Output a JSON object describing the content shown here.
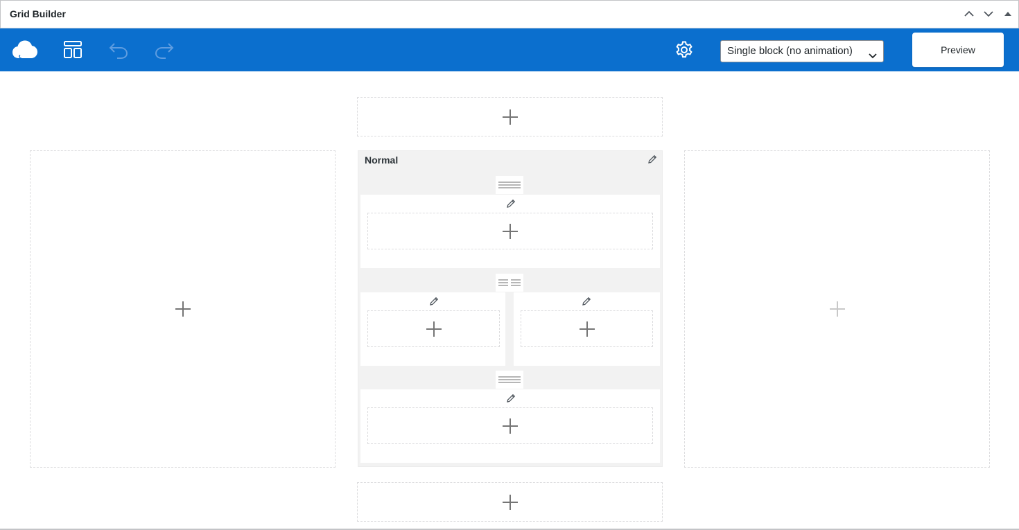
{
  "panel": {
    "title": "Grid Builder",
    "controls": [
      "move-up-icon",
      "move-down-icon",
      "toggle-panel-icon"
    ]
  },
  "toolbar": {
    "logo_icon": "cloud-icon",
    "layout_icon": "layout-icon",
    "undo_icon": "undo-icon",
    "redo_icon": "redo-icon",
    "settings_icon": "gear-icon",
    "animation_select": {
      "selected": "Single block (no animation)"
    },
    "preview_label": "Preview",
    "accent_color": "#0b6fce"
  },
  "block": {
    "title": "Normal",
    "rows": [
      {
        "layout": "one-column",
        "columns": 1
      },
      {
        "layout": "two-columns",
        "columns": 2
      },
      {
        "layout": "one-column",
        "columns": 1
      }
    ]
  }
}
